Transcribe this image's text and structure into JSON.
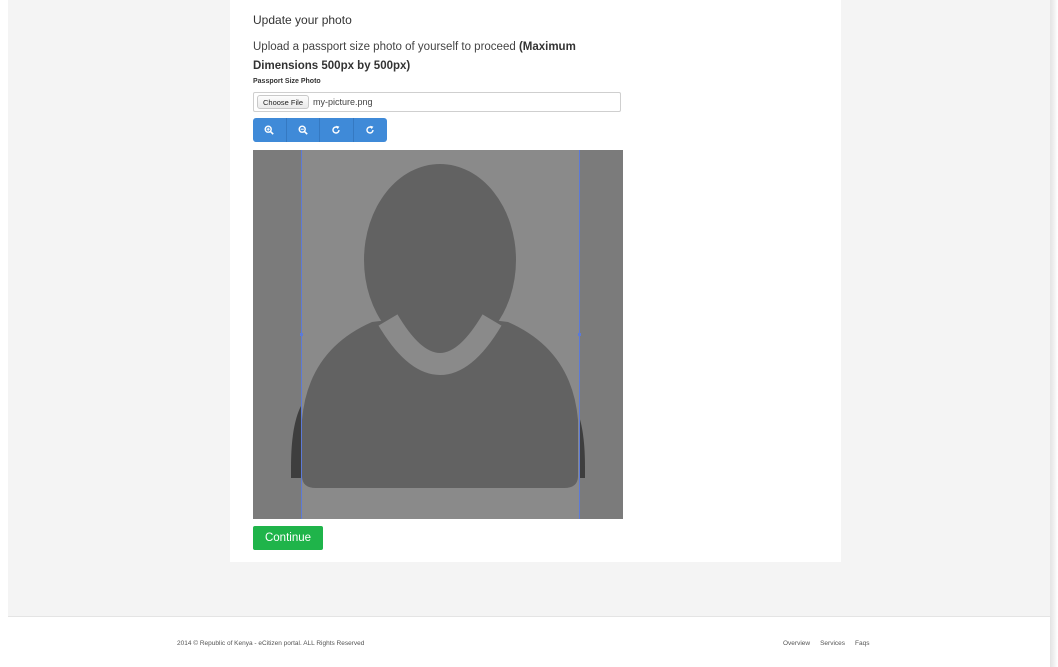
{
  "form": {
    "title": "Update your photo",
    "description_lead": "Upload a passport size photo of yourself to proceed ",
    "description_bold": "(Maximum Dimensions 500px by 500px)",
    "field_label": "Passport Size Photo",
    "choose_file_label": "Choose File",
    "selected_file": "my-picture.png",
    "continue_label": "Continue"
  },
  "toolbar": {
    "buttons": [
      {
        "icon": "zoom-in-icon"
      },
      {
        "icon": "zoom-out-icon"
      },
      {
        "icon": "rotate-left-icon"
      },
      {
        "icon": "rotate-right-icon"
      }
    ]
  },
  "footer": {
    "copyright": "2014 © Republic of Kenya - eCitizen portal. ALL Rights Reserved",
    "links": [
      "Overview",
      "Services",
      "Faqs"
    ]
  },
  "colors": {
    "toolbar_blue": "#3f8ad8",
    "continue_green": "#1fb44a",
    "crop_guide_blue": "#5c7ad8"
  }
}
